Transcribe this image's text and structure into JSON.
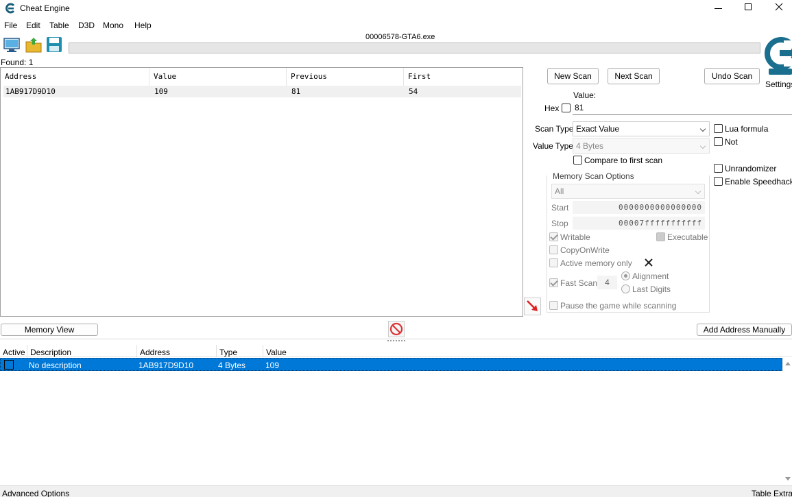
{
  "window": {
    "title": "Cheat Engine"
  },
  "menu": [
    "File",
    "Edit",
    "Table",
    "D3D",
    "Mono",
    "Help"
  ],
  "process": "00006578-GTA6.exe",
  "found": "Found: 1",
  "results": {
    "headers": [
      "Address",
      "Value",
      "Previous",
      "First"
    ],
    "rows": [
      {
        "address": "1AB917D9D10",
        "value": "109",
        "previous": "81",
        "first": "54"
      }
    ]
  },
  "buttons": {
    "new_scan": "New Scan",
    "next_scan": "Next Scan",
    "undo_scan": "Undo Scan",
    "settings": "Settings",
    "memory_view": "Memory View",
    "add_address": "Add Address Manually"
  },
  "scan": {
    "value_label": "Value:",
    "hex_label": "Hex",
    "value": "81",
    "scan_type_label": "Scan Type",
    "scan_type": "Exact Value",
    "value_type_label": "Value Type",
    "value_type": "4 Bytes",
    "compare_first": "Compare to first scan",
    "lua_formula": "Lua formula",
    "not": "Not",
    "unrandomizer": "Unrandomizer",
    "speedhack": "Enable Speedhack"
  },
  "memory_options": {
    "title": "Memory Scan Options",
    "region": "All",
    "start_label": "Start",
    "start": "0000000000000000",
    "stop_label": "Stop",
    "stop": "00007fffffffffff",
    "writable": "Writable",
    "executable": "Executable",
    "copy_on_write": "CopyOnWrite",
    "active_memory": "Active memory only",
    "fast_scan": "Fast Scan",
    "fast_scan_value": "4",
    "alignment": "Alignment",
    "last_digits": "Last Digits",
    "pause_game": "Pause the game while scanning"
  },
  "addr_table": {
    "headers": [
      "Active",
      "Description",
      "Address",
      "Type",
      "Value"
    ],
    "rows": [
      {
        "description": "No description",
        "address": "1AB917D9D10",
        "type": "4 Bytes",
        "value": "109"
      }
    ]
  },
  "footer": {
    "advanced": "Advanced Options",
    "extras": "Table Extras"
  },
  "colors": {
    "selection": "#0078d7",
    "logo": "#1a6e8e"
  }
}
